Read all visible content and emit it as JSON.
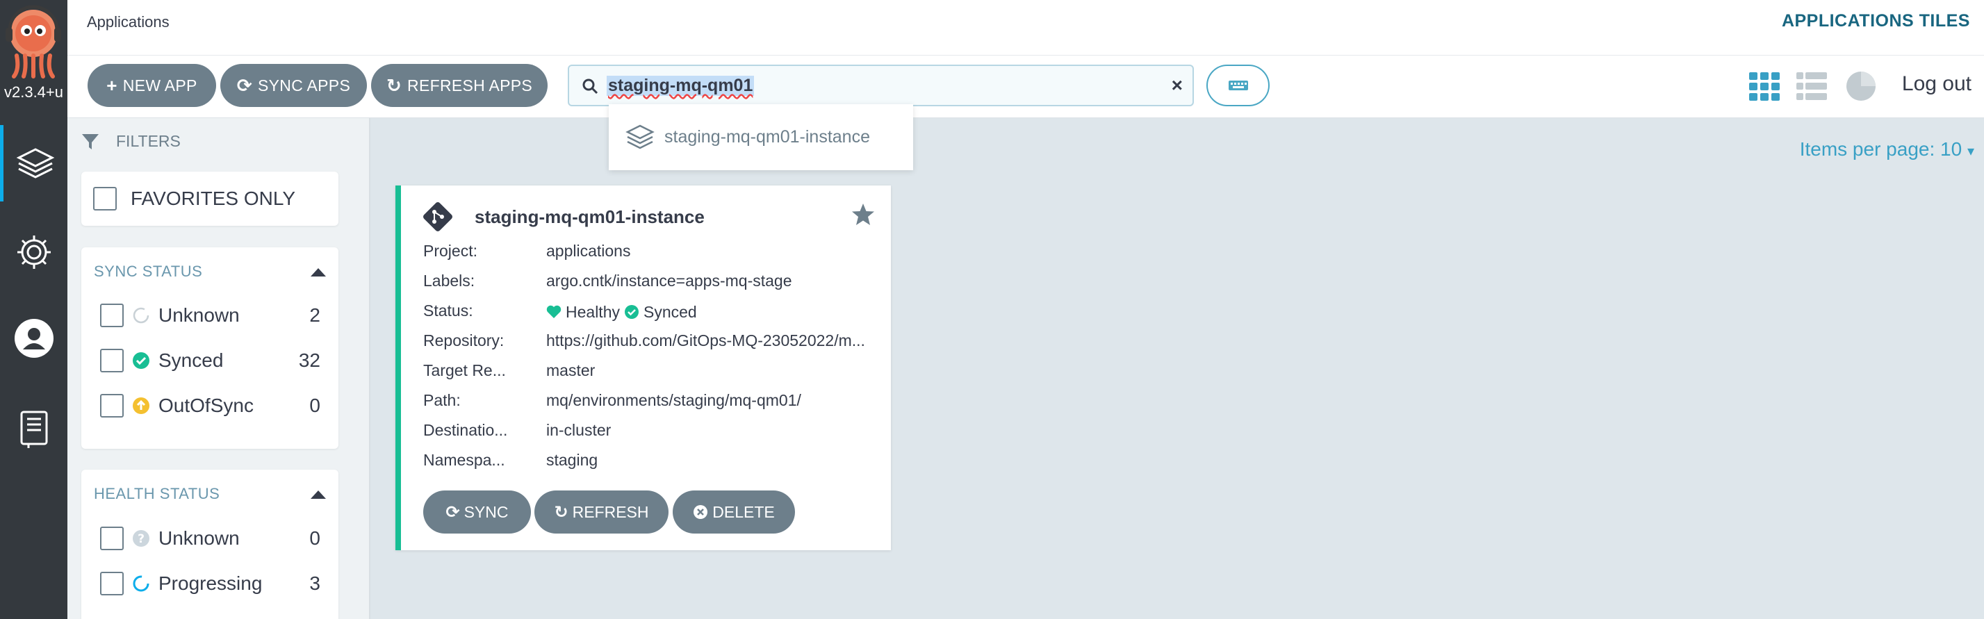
{
  "nav": {
    "version": "v2.3.4+u",
    "items": [
      "applications",
      "settings",
      "user-info",
      "documentation"
    ]
  },
  "header": {
    "breadcrumb": "Applications",
    "title": "APPLICATIONS TILES"
  },
  "toolbar": {
    "new_app": "NEW APP",
    "sync_apps": "SYNC APPS",
    "refresh_apps": "REFRESH APPS",
    "search_value": "staging-mq-qm01",
    "clear": "×",
    "logout": "Log out"
  },
  "dropdown": {
    "item": "staging-mq-qm01-instance"
  },
  "filters": {
    "heading": "FILTERS",
    "favorites_only": "FAVORITES ONLY",
    "sync_status": {
      "title": "SYNC STATUS",
      "rows": [
        {
          "label": "Unknown",
          "count": "2",
          "icon": "circle-notch-icon"
        },
        {
          "label": "Synced",
          "count": "32",
          "icon": "check-circle-icon"
        },
        {
          "label": "OutOfSync",
          "count": "0",
          "icon": "arrow-up-circle-icon"
        }
      ]
    },
    "health_status": {
      "title": "HEALTH STATUS",
      "rows": [
        {
          "label": "Unknown",
          "count": "0",
          "icon": "question-circle-icon"
        },
        {
          "label": "Progressing",
          "count": "3",
          "icon": "spinner-icon"
        }
      ]
    }
  },
  "main": {
    "items_per_page": "Items per page: 10"
  },
  "tile": {
    "name": "staging-mq-qm01-instance",
    "fields": [
      {
        "key": "Project:",
        "value": "applications"
      },
      {
        "key": "Labels:",
        "value": "argo.cntk/instance=apps-mq-stage"
      },
      {
        "key": "Status:",
        "value": ""
      },
      {
        "key": "Repository:",
        "value": "https://github.com/GitOps-MQ-23052022/m..."
      },
      {
        "key": "Target Re...",
        "value": "master"
      },
      {
        "key": "Path:",
        "value": "mq/environments/staging/mq-qm01/"
      },
      {
        "key": "Destinatio...",
        "value": "in-cluster"
      },
      {
        "key": "Namespa...",
        "value": "staging"
      }
    ],
    "health": "Healthy",
    "sync": "Synced",
    "buttons": {
      "sync": "SYNC",
      "refresh": "REFRESH",
      "delete": "DELETE"
    }
  },
  "colors": {
    "accent": "#18be94",
    "button": "#6d7f8b",
    "link": "#39a0c5",
    "warning": "#f4c030"
  }
}
